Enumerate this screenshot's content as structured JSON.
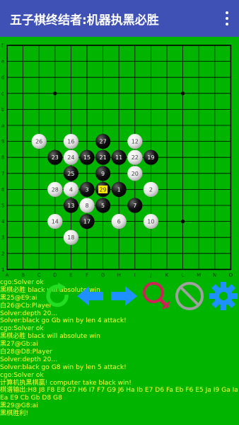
{
  "app": {
    "title": "五子棋终结者:机器执黑必胜",
    "menu_icon": "more-vert-icon"
  },
  "board": {
    "size": 15,
    "row_labels": [
      "f",
      "e",
      "d",
      "c",
      "b",
      "a",
      "9",
      "8",
      "7",
      "6",
      "5",
      "4",
      "3",
      "2",
      "1"
    ],
    "col_labels": [
      "A",
      "B",
      "C",
      "D",
      "E",
      "F",
      "G",
      "H",
      "I",
      "J",
      "K",
      "L",
      "M",
      "N",
      "O"
    ],
    "last_move": {
      "col": 6,
      "row": 9
    },
    "star_points": [
      [
        3,
        3
      ],
      [
        11,
        3
      ],
      [
        3,
        11
      ],
      [
        11,
        11
      ]
    ],
    "stones": [
      {
        "n": "1",
        "c": "b",
        "col": 7,
        "row": 9
      },
      {
        "n": "2",
        "c": "w",
        "col": 9,
        "row": 9
      },
      {
        "n": "3",
        "c": "b",
        "col": 5,
        "row": 9
      },
      {
        "n": "4",
        "c": "w",
        "col": 4,
        "row": 9
      },
      {
        "n": "5",
        "c": "b",
        "col": 6,
        "row": 10
      },
      {
        "n": "6",
        "c": "w",
        "col": 7,
        "row": 11
      },
      {
        "n": "7",
        "c": "b",
        "col": 8,
        "row": 10
      },
      {
        "n": "8",
        "c": "w",
        "col": 5,
        "row": 10
      },
      {
        "n": "9",
        "c": "b",
        "col": 6,
        "row": 8
      },
      {
        "n": "10",
        "c": "w",
        "col": 9,
        "row": 11
      },
      {
        "n": "11",
        "c": "b",
        "col": 7,
        "row": 7
      },
      {
        "n": "12",
        "c": "w",
        "col": 8,
        "row": 6
      },
      {
        "n": "13",
        "c": "b",
        "col": 4,
        "row": 10
      },
      {
        "n": "14",
        "c": "w",
        "col": 3,
        "row": 11
      },
      {
        "n": "15",
        "c": "b",
        "col": 5,
        "row": 7
      },
      {
        "n": "16",
        "c": "w",
        "col": 4,
        "row": 6
      },
      {
        "n": "17",
        "c": "b",
        "col": 5,
        "row": 11
      },
      {
        "n": "18",
        "c": "w",
        "col": 4,
        "row": 12
      },
      {
        "n": "19",
        "c": "b",
        "col": 9,
        "row": 7
      },
      {
        "n": "20",
        "c": "w",
        "col": 8,
        "row": 8
      },
      {
        "n": "21",
        "c": "b",
        "col": 6,
        "row": 7
      },
      {
        "n": "22",
        "c": "w",
        "col": 8,
        "row": 7
      },
      {
        "n": "23",
        "c": "b",
        "col": 3,
        "row": 7
      },
      {
        "n": "24",
        "c": "w",
        "col": 4,
        "row": 7
      },
      {
        "n": "25",
        "c": "b",
        "col": 4,
        "row": 8
      },
      {
        "n": "26",
        "c": "w",
        "col": 2,
        "row": 6
      },
      {
        "n": "27",
        "c": "b",
        "col": 6,
        "row": 6
      },
      {
        "n": "28",
        "c": "w",
        "col": 3,
        "row": 9
      },
      {
        "n": "29",
        "c": "b",
        "col": 6,
        "row": 9
      }
    ]
  },
  "toolbar": {
    "buttons": [
      {
        "name": "restart-icon"
      },
      {
        "name": "undo-arrow-icon"
      },
      {
        "name": "redo-arrow-icon"
      },
      {
        "name": "search-icon"
      },
      {
        "name": "forbidden-icon"
      },
      {
        "name": "settings-gear-icon"
      }
    ]
  },
  "colors": {
    "background": "#00b400",
    "appbar": "#3f51b5",
    "log_text": "#ffff33",
    "accent_green": "#22dd22",
    "accent_blue": "#1e90ff",
    "accent_red": "#cc2255",
    "accent_gray": "#a0a0a0"
  },
  "log": [
    "cgo:Solver ok",
    "黑棋必胜 black will absolute win",
    "黑25@E9:ai",
    "白26@Cb:Player",
    "Solver:depth 20...",
    "Solver:black go Gb win by len 4 attack!",
    "cgo:Solver ok",
    "黑棋必胜 black will absolute win",
    "黑27@Gb:ai",
    "白28@D8:Player",
    "Solver:depth 20...",
    "Solver:black go G8 win by len 5 attack!",
    "cgo:Solver ok",
    "计算机执黑棋赢! computer take black win!",
    "棋谱输出:H8 J8 F8 E8 G7 H6 I7 F7 G9 J6 Ha Ib E7 D6 Fa Eb F6 E5 Ja I9 Ga Ia Da",
    "Ea E9 Cb Gb D8 G8",
    "黑29@G8:ai",
    "黑棋胜利!"
  ]
}
